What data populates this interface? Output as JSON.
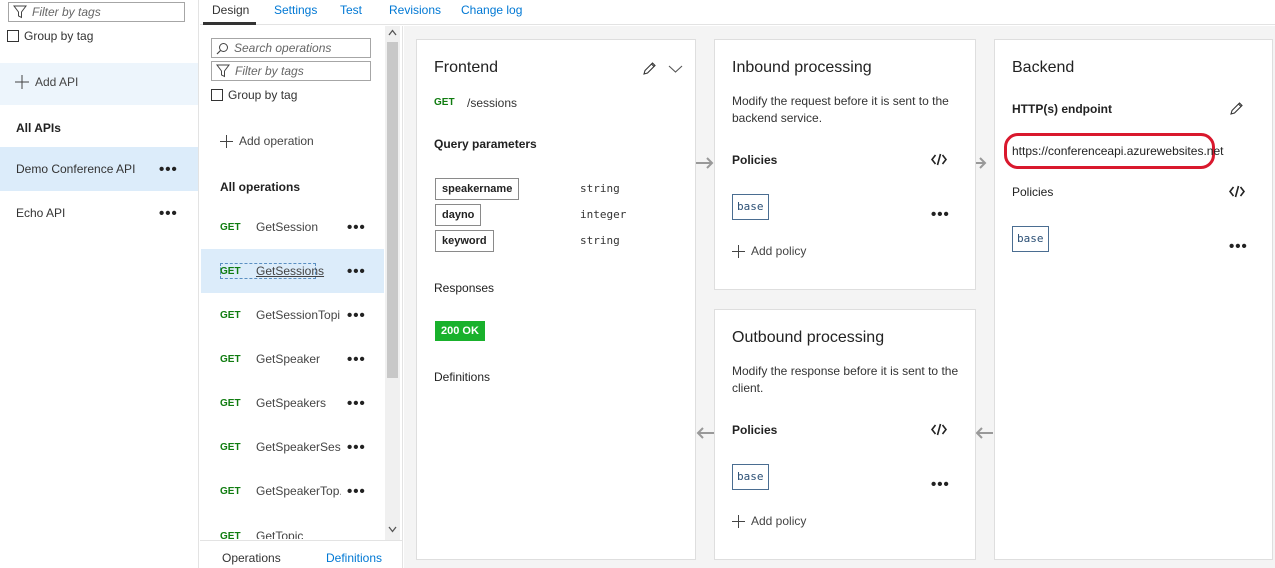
{
  "api_panel": {
    "filter_placeholder": "Filter by tags",
    "group_by_label": "Group by tag",
    "add_api_label": "Add API",
    "section_title": "All APIs",
    "apis": [
      {
        "name": "Demo Conference API",
        "selected": true
      },
      {
        "name": "Echo API",
        "selected": false
      }
    ]
  },
  "tabs": [
    "Design",
    "Settings",
    "Test",
    "Revisions",
    "Change log"
  ],
  "active_tab": "Design",
  "ops_panel": {
    "search_placeholder": "Search operations",
    "filter_placeholder": "Filter by tags",
    "group_by_label": "Group by tag",
    "add_operation_label": "Add operation",
    "section_title": "All operations",
    "operations": [
      {
        "method": "GET",
        "name": "GetSession"
      },
      {
        "method": "GET",
        "name": "GetSessions",
        "selected": true
      },
      {
        "method": "GET",
        "name": "GetSessionTopi..."
      },
      {
        "method": "GET",
        "name": "GetSpeaker"
      },
      {
        "method": "GET",
        "name": "GetSpeakers"
      },
      {
        "method": "GET",
        "name": "GetSpeakerSes..."
      },
      {
        "method": "GET",
        "name": "GetSpeakerTop..."
      },
      {
        "method": "GET",
        "name": "GetTopic"
      }
    ],
    "bottom_tabs": [
      "Operations",
      "Definitions"
    ]
  },
  "frontend": {
    "title": "Frontend",
    "method": "GET",
    "path": "/sessions",
    "query_params_label": "Query parameters",
    "params": [
      {
        "name": "speakername",
        "type": "string"
      },
      {
        "name": "dayno",
        "type": "integer"
      },
      {
        "name": "keyword",
        "type": "string"
      }
    ],
    "responses_label": "Responses",
    "response_badge": "200 OK",
    "definitions_label": "Definitions"
  },
  "inbound": {
    "title": "Inbound processing",
    "description_line1": "Modify the request before it is sent to the",
    "description_line2": "backend service.",
    "policies_label": "Policies",
    "policy_chip": "base",
    "add_policy_label": "Add policy"
  },
  "outbound": {
    "title": "Outbound processing",
    "description_line1": "Modify the response before it is sent to the",
    "description_line2": "client.",
    "policies_label": "Policies",
    "policy_chip": "base",
    "add_policy_label": "Add policy"
  },
  "backend": {
    "title": "Backend",
    "endpoint_label": "HTTP(s) endpoint",
    "endpoint_url": "https://conferenceapi.azurewebsites.net",
    "policies_label": "Policies",
    "policy_chip": "base"
  },
  "colors": {
    "accent": "#0078d4",
    "get_method": "#107c10",
    "selected_row": "#dcecfa",
    "highlight_ring": "#d9182d",
    "ok_badge": "#19b12c"
  }
}
